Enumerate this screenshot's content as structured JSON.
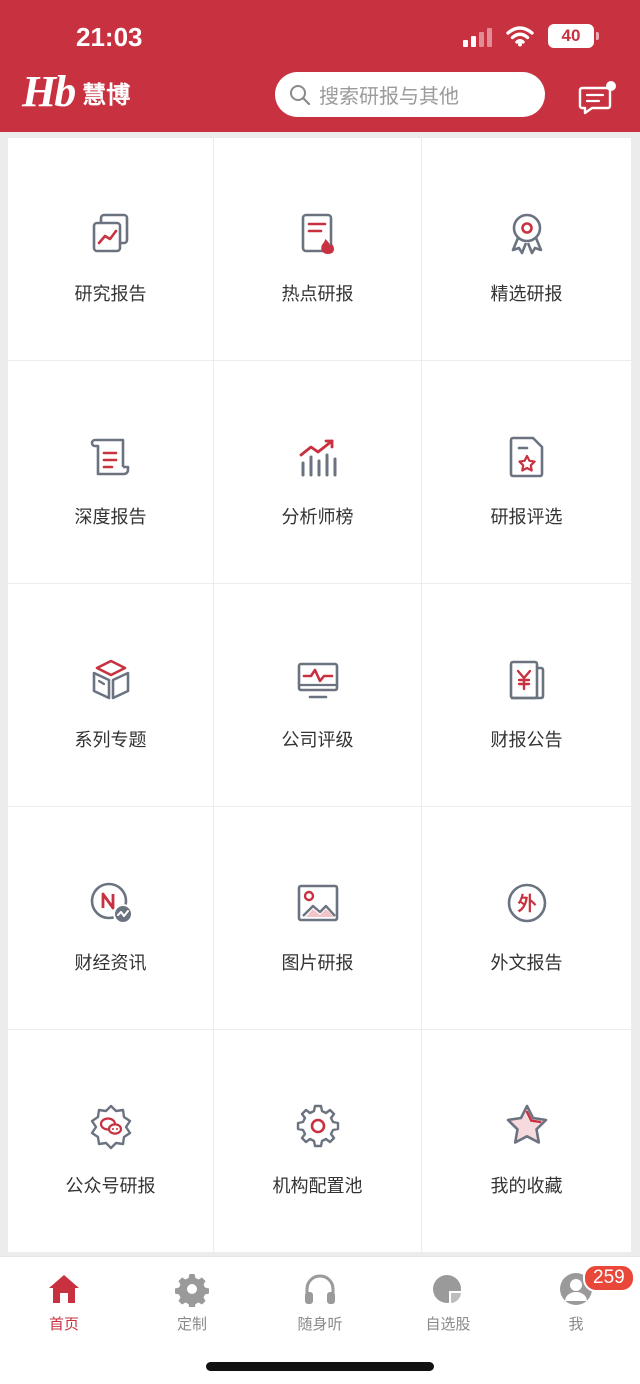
{
  "status": {
    "time": "21:03",
    "battery": "40"
  },
  "brand": {
    "mark": "Hb",
    "name": "慧博"
  },
  "search": {
    "placeholder": "搜索研报与其他"
  },
  "grid": [
    {
      "label": "研究报告",
      "icon": "research-report-icon"
    },
    {
      "label": "热点研报",
      "icon": "hot-report-icon"
    },
    {
      "label": "精选研报",
      "icon": "award-ribbon-icon"
    },
    {
      "label": "深度报告",
      "icon": "scroll-document-icon"
    },
    {
      "label": "分析师榜",
      "icon": "bar-chart-up-icon"
    },
    {
      "label": "研报评选",
      "icon": "star-document-icon"
    },
    {
      "label": "系列专题",
      "icon": "box-cube-icon"
    },
    {
      "label": "公司评级",
      "icon": "monitor-pulse-icon"
    },
    {
      "label": "财报公告",
      "icon": "yen-document-icon"
    },
    {
      "label": "财经资讯",
      "icon": "news-circle-icon"
    },
    {
      "label": "图片研报",
      "icon": "image-icon"
    },
    {
      "label": "外文报告",
      "icon": "foreign-text-icon"
    },
    {
      "label": "公众号研报",
      "icon": "wechat-badge-icon"
    },
    {
      "label": "机构配置池",
      "icon": "gear-icon"
    },
    {
      "label": "我的收藏",
      "icon": "star-icon"
    }
  ],
  "tabs": [
    {
      "label": "首页",
      "icon": "home-icon",
      "active": true
    },
    {
      "label": "定制",
      "icon": "gear-icon"
    },
    {
      "label": "随身听",
      "icon": "headphones-icon"
    },
    {
      "label": "自选股",
      "icon": "pie-chart-icon"
    },
    {
      "label": "我",
      "icon": "user-avatar-icon"
    }
  ],
  "badge": {
    "count": "259"
  },
  "colors": {
    "brand": "#c8313f",
    "icon_gray": "#6b7280",
    "badge": "#e8473a"
  }
}
